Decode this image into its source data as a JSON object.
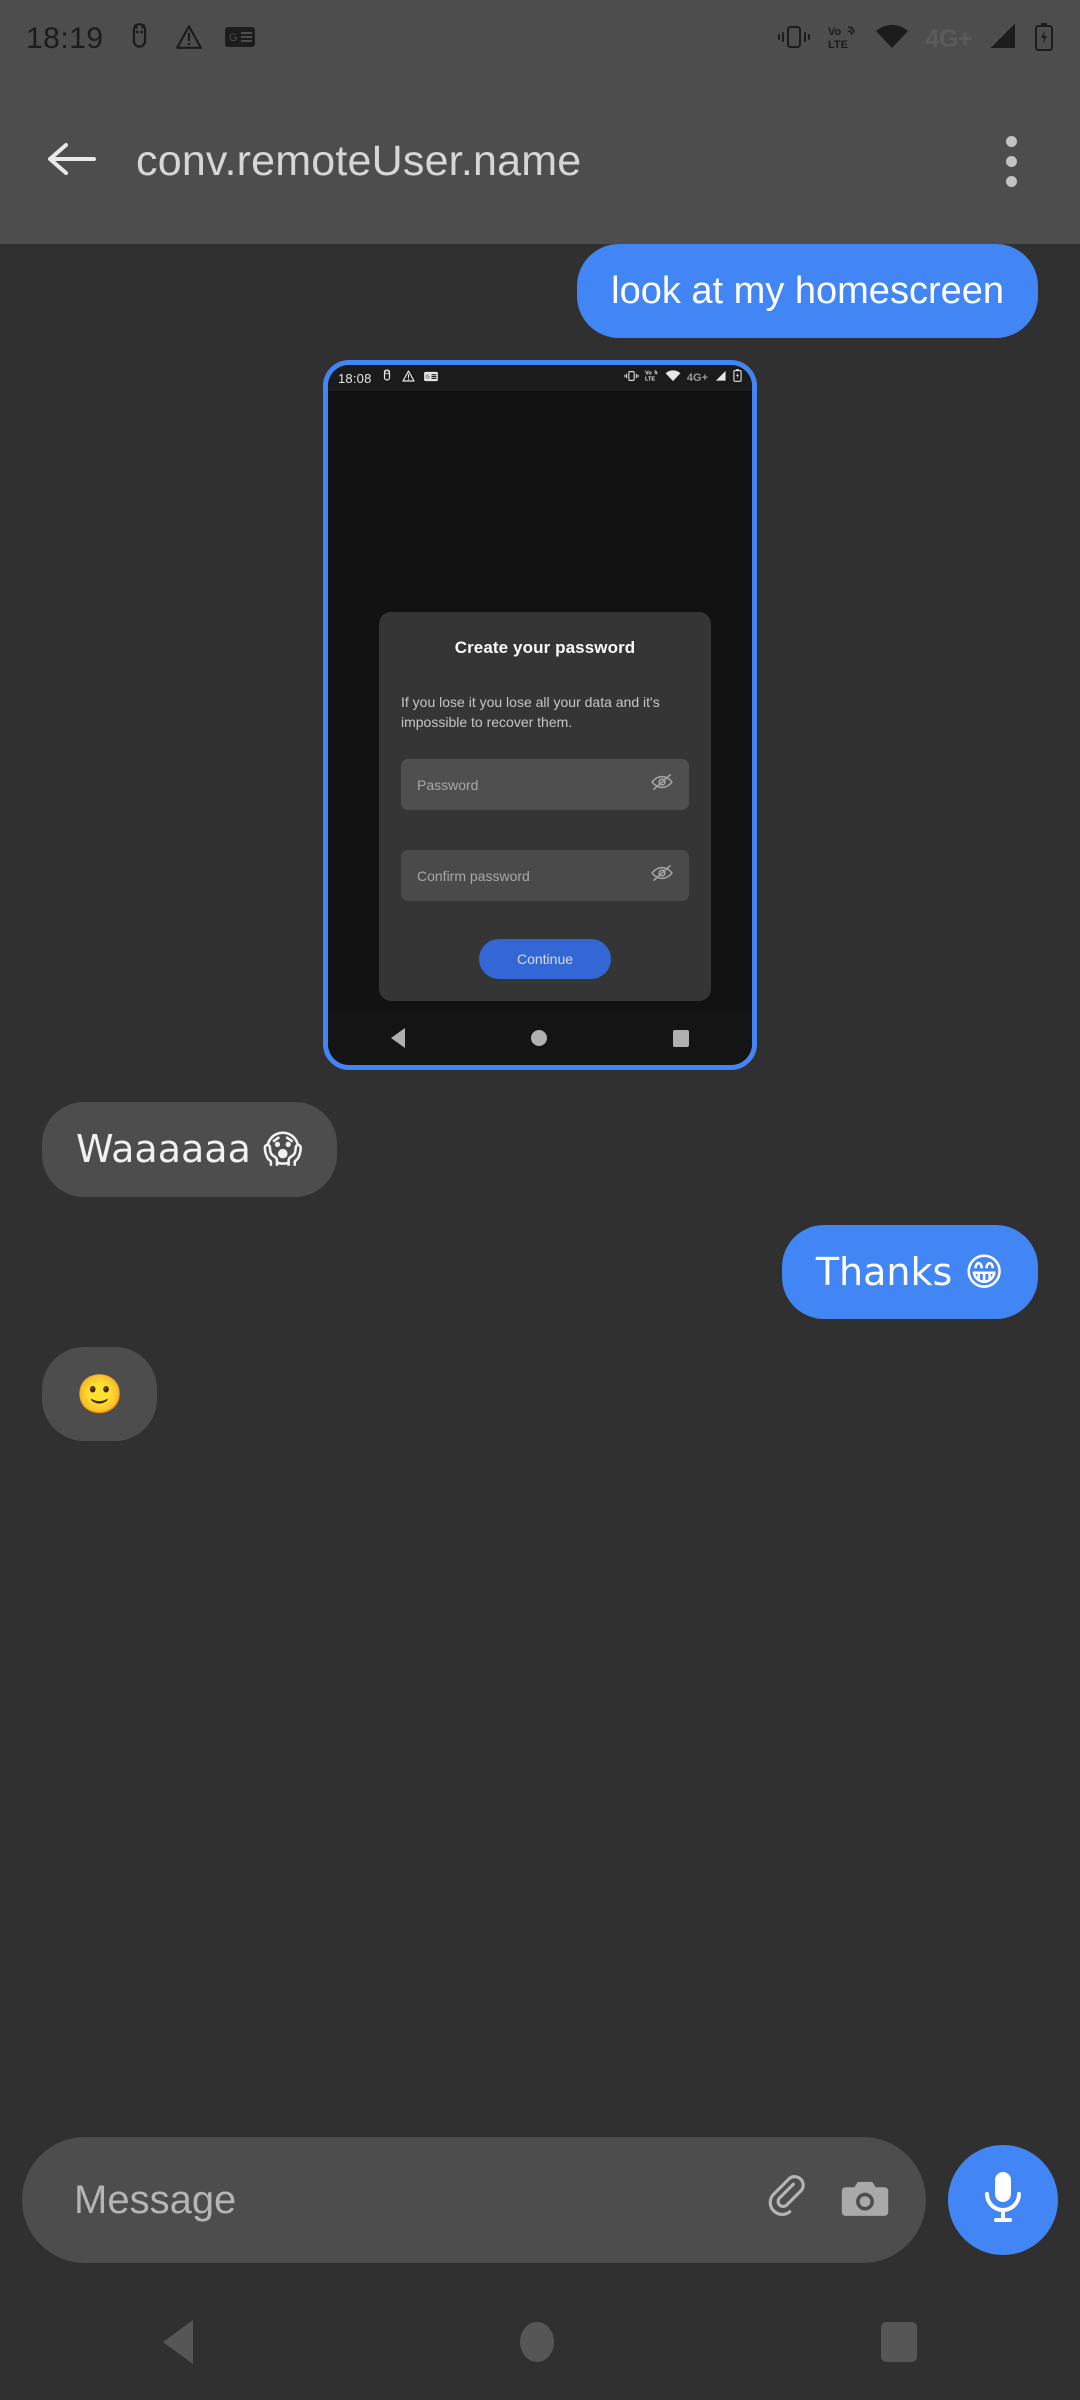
{
  "status_bar": {
    "time": "18:19",
    "network_label": "4G+",
    "left_icons": [
      "android-debug-icon",
      "warning-triangle-icon",
      "news-card-icon"
    ],
    "right_icons": [
      "vibrate-icon",
      "volte-icon",
      "wifi-icon",
      "signal-icon",
      "battery-charging-icon"
    ]
  },
  "app_bar": {
    "title": "conv.remoteUser.name",
    "back_icon": "arrow-back-icon",
    "overflow_icon": "more-vertical-icon"
  },
  "messages": [
    {
      "id": "m1",
      "direction": "out",
      "text": "look at my homescreen"
    },
    {
      "id": "m2",
      "direction": "out",
      "type": "image",
      "alt": "embedded screenshot attachment"
    },
    {
      "id": "m3",
      "direction": "in",
      "text": "Waaaaaa 😱"
    },
    {
      "id": "m4",
      "direction": "out",
      "text": "Thanks 😁"
    }
  ],
  "embedded_screenshot": {
    "status_bar": {
      "time": "18:08",
      "network_label": "4G+",
      "left_icons": [
        "android-debug-icon",
        "warning-triangle-icon",
        "news-card-icon"
      ],
      "right_icons": [
        "vibrate-icon",
        "volte-icon",
        "wifi-icon",
        "signal-icon",
        "battery-charging-icon"
      ]
    },
    "dialog": {
      "title": "Create your password",
      "body": "If you lose it you lose all your data and it's impossible to recover them.",
      "password_placeholder": "Password",
      "confirm_placeholder": "Confirm password",
      "visibility_icon": "eye-off-icon",
      "continue_label": "Continue"
    },
    "nav_bar": {
      "back_icon": "nav-back-triangle-icon",
      "home_icon": "nav-home-circle-icon",
      "recents_icon": "nav-recents-square-icon"
    }
  },
  "composer": {
    "placeholder": "Message",
    "attach_icon": "paperclip-icon",
    "camera_icon": "camera-icon",
    "mic_icon": "microphone-icon"
  },
  "system_nav": {
    "back_icon": "nav-back-triangle-icon",
    "home_icon": "nav-home-circle-icon",
    "recents_icon": "nav-recents-square-icon"
  },
  "colors": {
    "accent_blue": "#4285f4",
    "bar_gray": "#4d4d4d",
    "conversation_bg": "#303030",
    "shot_bg": "#121212",
    "dialog_bg": "#353535",
    "button_blue": "#3367d6"
  }
}
